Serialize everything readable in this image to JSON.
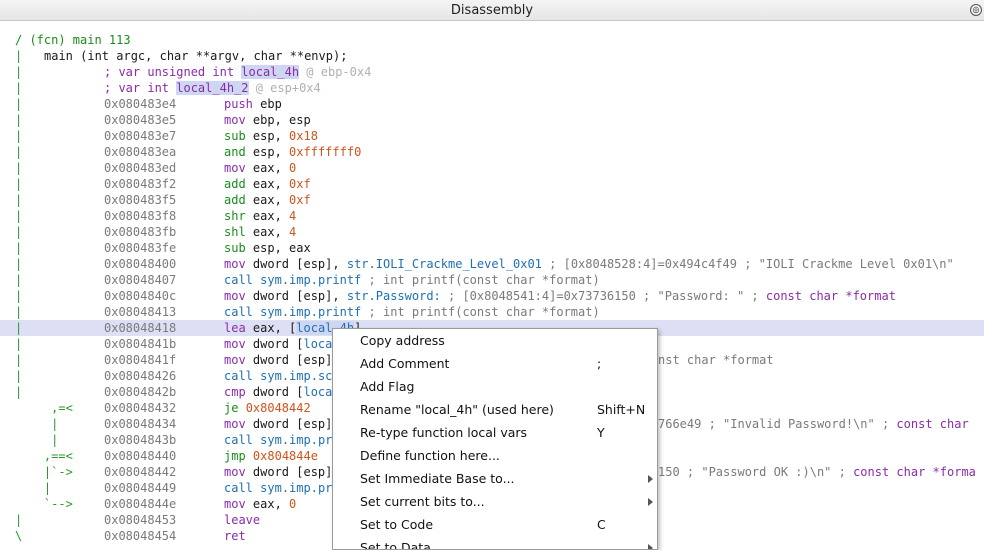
{
  "window": {
    "title": "Disassembly",
    "undock_glyph": "◎"
  },
  "header": {
    "fcn": "/ (fcn) main 113",
    "sig_gutter": "|",
    "sig": "main (int argc, char **argv, char **envp);",
    "vars": [
      {
        "gutter": "|",
        "pre": "; var unsigned int ",
        "name": "local_4h",
        "post": " @ ebp-0x4"
      },
      {
        "gutter": "|",
        "pre": "; var int ",
        "name": "local_4h_2",
        "post": " @ esp+0x4"
      }
    ]
  },
  "lines": [
    {
      "g": "|",
      "addr": "0x080483e4",
      "mn": "push",
      "ops": " ebp"
    },
    {
      "g": "|",
      "addr": "0x080483e5",
      "mn": "mov",
      "ops": " ebp, esp"
    },
    {
      "g": "|",
      "addr": "0x080483e7",
      "mn": "sub",
      "ops": " esp, ",
      "num": "0x18"
    },
    {
      "g": "|",
      "addr": "0x080483ea",
      "mn": "and",
      "ops": " esp, ",
      "num": "0xfffffff0"
    },
    {
      "g": "|",
      "addr": "0x080483ed",
      "mn": "mov",
      "ops": " eax, ",
      "num": "0"
    },
    {
      "g": "|",
      "addr": "0x080483f2",
      "mn": "add",
      "ops": " eax, ",
      "num": "0xf"
    },
    {
      "g": "|",
      "addr": "0x080483f5",
      "mn": "add",
      "ops": " eax, ",
      "num": "0xf"
    },
    {
      "g": "|",
      "addr": "0x080483f8",
      "mn": "shr",
      "ops": " eax, ",
      "num": "4"
    },
    {
      "g": "|",
      "addr": "0x080483fb",
      "mn": "shl",
      "ops": " eax, ",
      "num": "4"
    },
    {
      "g": "|",
      "addr": "0x080483fe",
      "mn": "sub",
      "ops": " esp, eax"
    },
    {
      "g": "|",
      "addr": "0x08048400",
      "mn": "mov",
      "ops": " dword [esp], ",
      "sym": "str.IOLI_Crackme_Level_0x01",
      "cmt": " ; [0x8048528:4]=0x494c4f49 ; \"IOLI Crackme Level 0x01\\n\""
    },
    {
      "g": "|",
      "addr": "0x08048407",
      "mn": "call",
      "ops": " ",
      "sym": "sym.imp.printf",
      "cmt": " ; int printf(const char *format)"
    },
    {
      "g": "|",
      "addr": "0x0804840c",
      "mn": "mov",
      "ops": " dword [esp], ",
      "sym": "str.Password:",
      "cmt": " ; [0x8048541:4]=0x73736150 ; \"Password: \" ; ",
      "ctype": "const char *format"
    },
    {
      "g": "|",
      "addr": "0x08048413",
      "mn": "call",
      "ops": " ",
      "sym": "sym.imp.printf",
      "cmt": " ; int printf(const char *format)"
    },
    {
      "g": "|",
      "addr": "0x08048418",
      "mn": "lea",
      "ops": " eax, [",
      "sym": "local_4h",
      "tail": "]",
      "sel": true
    },
    {
      "g": "|",
      "addr": "0x0804841b",
      "mn": "mov",
      "ops": " dword [",
      "sym": "loca"
    },
    {
      "g": "|",
      "addr": "0x0804841f",
      "mn": "mov",
      "ops": " dword [esp]",
      "rightcmt": "nst char *format"
    },
    {
      "g": "|",
      "addr": "0x08048426",
      "mn": "call",
      "ops": " ",
      "sym": "sym.imp.sc"
    },
    {
      "g": "|",
      "addr": "0x0804842b",
      "mn": "cmp",
      "ops": " dword [",
      "sym": "loca"
    },
    {
      "g": "     ,=<",
      "addr": "0x08048432",
      "mn": "je",
      "ops": " ",
      "num": "0x8048442"
    },
    {
      "g": "     |",
      "addr": "0x08048434",
      "mn": "mov",
      "ops": " dword [esp]",
      "rightcmt": "766e49 ; \"Invalid Password!\\n\" ; ",
      "rightctype": "const char"
    },
    {
      "g": "     |",
      "addr": "0x0804843b",
      "mn": "call",
      "ops": " ",
      "sym": "sym.imp.pr"
    },
    {
      "g": "    ,==<",
      "addr": "0x08048440",
      "mn": "jmp",
      "ops": " ",
      "num": "0x804844e"
    },
    {
      "g": "    |`->",
      "addr": "0x08048442",
      "mn": "mov",
      "ops": " dword [esp]",
      "rightcmt": "150 ; \"Password OK :)\\n\" ; ",
      "rightctype": "const char *forma"
    },
    {
      "g": "    |",
      "addr": "0x08048449",
      "mn": "call",
      "ops": " ",
      "sym": "sym.imp.pr"
    },
    {
      "g": "    `-->",
      "addr": "0x0804844e",
      "mn": "mov",
      "ops": " eax, ",
      "num": "0"
    },
    {
      "g": "|",
      "addr": "0x08048453",
      "mn": "leave",
      "ops": ""
    },
    {
      "g": "\\",
      "addr": "0x08048454",
      "mn": "ret",
      "ops": ""
    }
  ],
  "context_menu": {
    "items": [
      {
        "label": "Copy address",
        "shortcut": ""
      },
      {
        "label": "Add Comment",
        "shortcut": ";"
      },
      {
        "label": "Add Flag",
        "shortcut": ""
      },
      {
        "label": "Rename \"local_4h\" (used here)",
        "shortcut": "Shift+N"
      },
      {
        "label": "Re-type function local vars",
        "shortcut": "Y"
      },
      {
        "label": "Define function here...",
        "shortcut": ""
      },
      {
        "label": "Set Immediate Base to...",
        "shortcut": "",
        "submenu": true
      },
      {
        "label": "Set current bits to...",
        "shortcut": "",
        "submenu": true
      },
      {
        "label": "Set to Code",
        "shortcut": "C"
      },
      {
        "label": "Set to Data",
        "shortcut": "",
        "submenu": true
      }
    ]
  }
}
